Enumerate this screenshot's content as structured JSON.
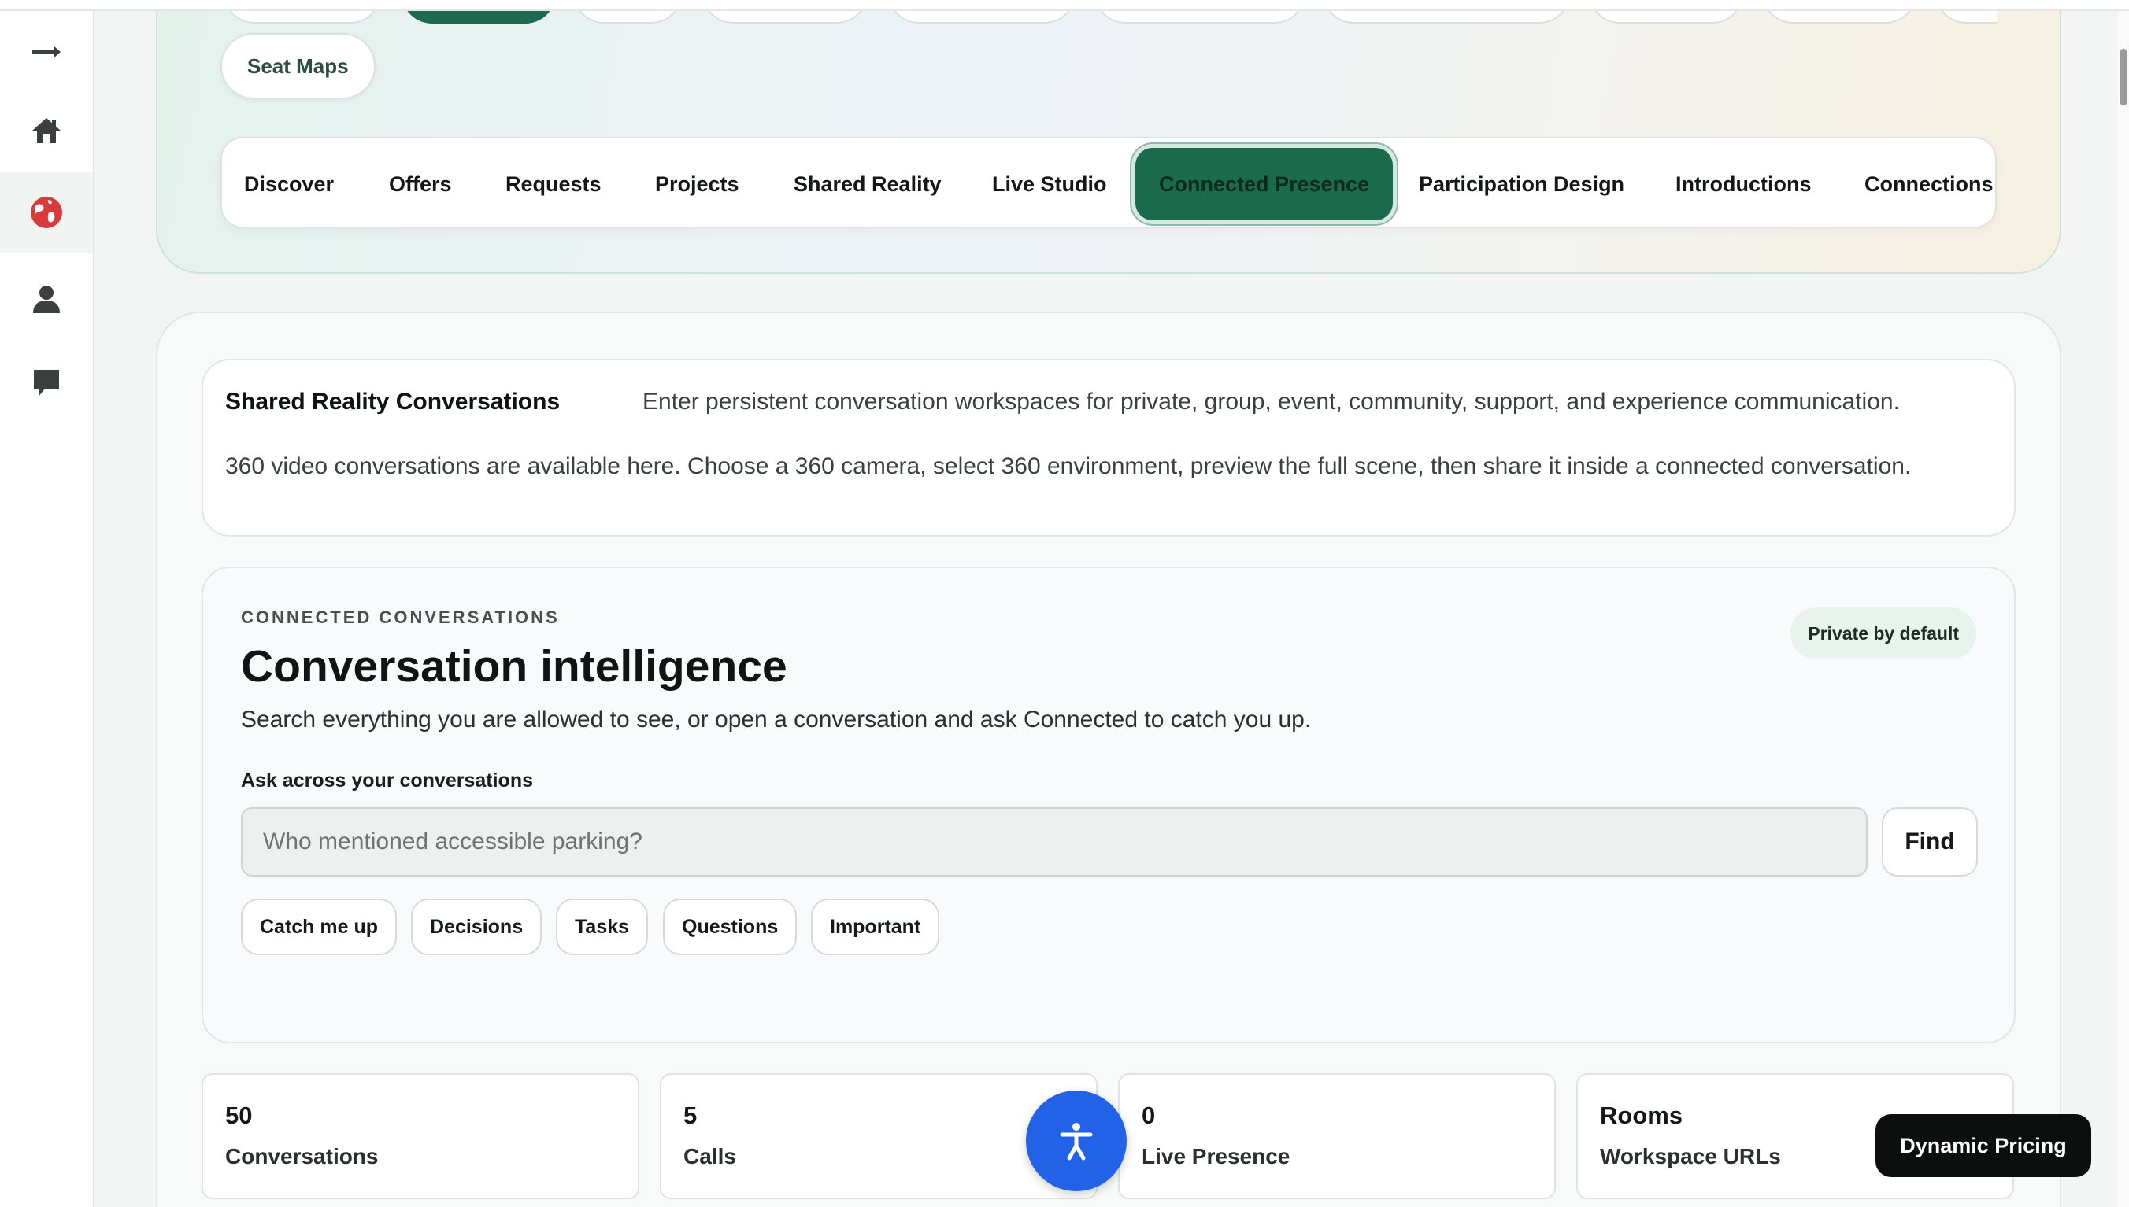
{
  "sidebar": {
    "items": [
      {
        "name": "collapse-arrow-icon"
      },
      {
        "name": "home-icon"
      },
      {
        "name": "globe-icon",
        "active": true
      },
      {
        "name": "person-icon"
      },
      {
        "name": "chat-bubble-icon"
      }
    ],
    "active_color": "#d93a3a",
    "icon_color": "#3b3f3e"
  },
  "hero": {
    "seat_maps_label": "Seat Maps",
    "nav_tabs": [
      {
        "label": "Discover"
      },
      {
        "label": "Offers"
      },
      {
        "label": "Requests"
      },
      {
        "label": "Projects"
      },
      {
        "label": "Shared Reality"
      },
      {
        "label": "Live Studio"
      },
      {
        "label": "Connected Presence",
        "active": true
      },
      {
        "label": "Participation Design"
      },
      {
        "label": "Introductions"
      },
      {
        "label": "Connections"
      }
    ]
  },
  "info": {
    "title": "Shared Reality Conversations",
    "subtitle": "Enter persistent conversation workspaces for private, group, event, community, support, and experience communication.",
    "body": "360 video conversations are available here. Choose a 360 camera, select 360 environment, preview the full scene, then share it inside a connected conversation."
  },
  "intelligence": {
    "eyebrow": "CONNECTED CONVERSATIONS",
    "badge": "Private by default",
    "title": "Conversation intelligence",
    "description": "Search everything you are allowed to see, or open a conversation and ask Connected to catch you up.",
    "ask_label": "Ask across your conversations",
    "search_placeholder": "Who mentioned accessible parking?",
    "find_label": "Find",
    "quick_actions": [
      "Catch me up",
      "Decisions",
      "Tasks",
      "Questions",
      "Important"
    ]
  },
  "stats": [
    {
      "value": "50",
      "label": "Conversations"
    },
    {
      "value": "5",
      "label": "Calls"
    },
    {
      "value": "0",
      "label": "Live Presence"
    },
    {
      "value": "Rooms",
      "label": "Workspace URLs"
    }
  ],
  "floating": {
    "accessibility_icon": "accessibility-icon",
    "pricing_label": "Dynamic Pricing"
  },
  "colors": {
    "brand_green": "#1a6a4d",
    "accessibility_blue": "#2262e6"
  }
}
